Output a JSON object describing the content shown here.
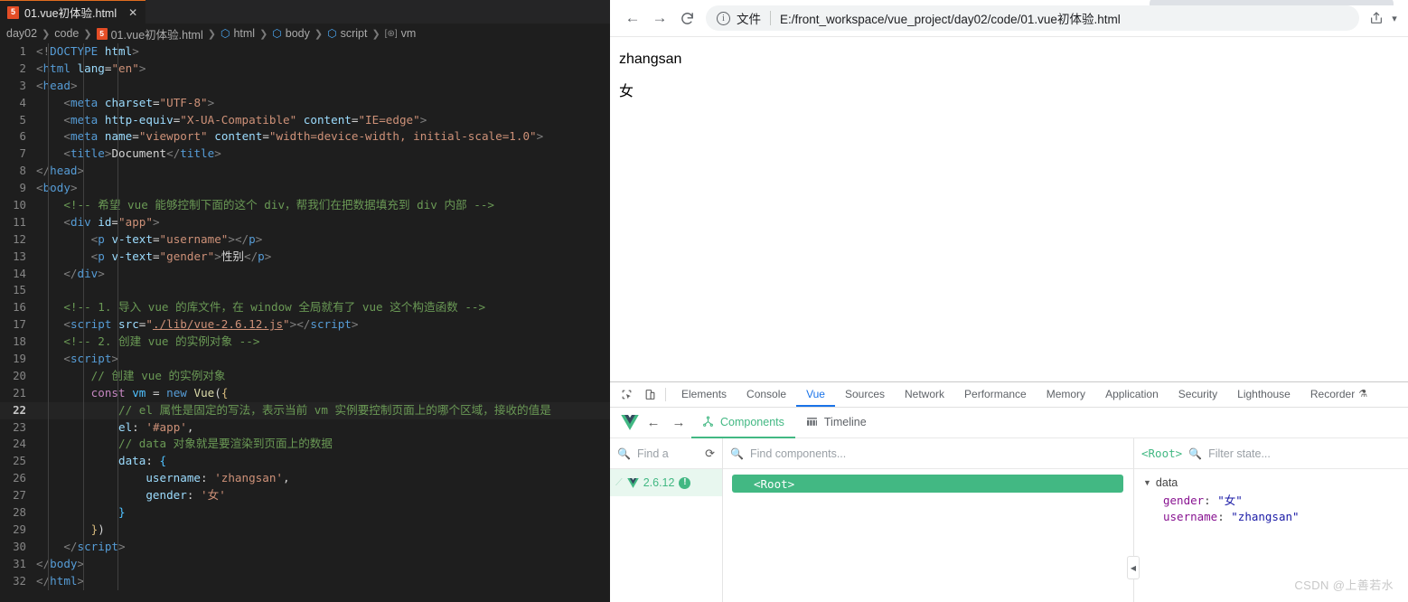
{
  "editor": {
    "tab": {
      "label": "01.vue初体验.html",
      "icon": "html5-icon",
      "close": "✕"
    },
    "breadcrumb": [
      "day02",
      "code",
      "01.vue初体验.html",
      "html",
      "body",
      "script",
      "vm"
    ],
    "lines": [
      {
        "n": 1,
        "html": "<span class='t-brk'>&lt;!</span><span class='t-tag'>DOCTYPE</span> <span class='t-attr'>html</span><span class='t-brk'>&gt;</span>"
      },
      {
        "n": 2,
        "html": "<span class='t-brk'>&lt;</span><span class='t-tag'>html</span> <span class='t-attr'>lang</span><span class='t-punc'>=</span><span class='t-str'>\"en\"</span><span class='t-brk'>&gt;</span>"
      },
      {
        "n": 3,
        "html": "<span class='t-brk'>&lt;</span><span class='t-tag'>head</span><span class='t-brk'>&gt;</span>"
      },
      {
        "n": 4,
        "html": "    <span class='t-brk'>&lt;</span><span class='t-tag'>meta</span> <span class='t-attr'>charset</span><span class='t-punc'>=</span><span class='t-str'>\"UTF-8\"</span><span class='t-brk'>&gt;</span>"
      },
      {
        "n": 5,
        "html": "    <span class='t-brk'>&lt;</span><span class='t-tag'>meta</span> <span class='t-attr'>http-equiv</span><span class='t-punc'>=</span><span class='t-str'>\"X-UA-Compatible\"</span> <span class='t-attr'>content</span><span class='t-punc'>=</span><span class='t-str'>\"IE=edge\"</span><span class='t-brk'>&gt;</span>"
      },
      {
        "n": 6,
        "html": "    <span class='t-brk'>&lt;</span><span class='t-tag'>meta</span> <span class='t-attr'>name</span><span class='t-punc'>=</span><span class='t-str'>\"viewport\"</span> <span class='t-attr'>content</span><span class='t-punc'>=</span><span class='t-str'>\"width=device-width, initial-scale=1.0\"</span><span class='t-brk'>&gt;</span>"
      },
      {
        "n": 7,
        "html": "    <span class='t-brk'>&lt;</span><span class='t-tag'>title</span><span class='t-brk'>&gt;</span><span class='t-txt'>Document</span><span class='t-brk'>&lt;/</span><span class='t-tag'>title</span><span class='t-brk'>&gt;</span>"
      },
      {
        "n": 8,
        "html": "<span class='t-brk'>&lt;/</span><span class='t-tag'>head</span><span class='t-brk'>&gt;</span>"
      },
      {
        "n": 9,
        "html": "<span class='t-brk'>&lt;</span><span class='t-tag'>body</span><span class='t-brk'>&gt;</span>"
      },
      {
        "n": 10,
        "html": "    <span class='t-cmt'>&lt;!-- 希望 vue 能够控制下面的这个 div，帮我们在把数据填充到 div 内部 --&gt;</span>"
      },
      {
        "n": 11,
        "html": "    <span class='t-brk'>&lt;</span><span class='t-tag'>div</span> <span class='t-attr'>id</span><span class='t-punc'>=</span><span class='t-str'>\"app\"</span><span class='t-brk'>&gt;</span>"
      },
      {
        "n": 12,
        "html": "        <span class='t-brk'>&lt;</span><span class='t-tag'>p</span> <span class='t-attr'>v-text</span><span class='t-punc'>=</span><span class='t-str'>\"username\"</span><span class='t-brk'>&gt;&lt;/</span><span class='t-tag'>p</span><span class='t-brk'>&gt;</span>"
      },
      {
        "n": 13,
        "html": "        <span class='t-brk'>&lt;</span><span class='t-tag'>p</span> <span class='t-attr'>v-text</span><span class='t-punc'>=</span><span class='t-str'>\"gender\"</span><span class='t-brk'>&gt;</span><span class='t-txt'>性别</span><span class='t-brk'>&lt;/</span><span class='t-tag'>p</span><span class='t-brk'>&gt;</span>"
      },
      {
        "n": 14,
        "html": "    <span class='t-brk'>&lt;/</span><span class='t-tag'>div</span><span class='t-brk'>&gt;</span>"
      },
      {
        "n": 15,
        "html": ""
      },
      {
        "n": 16,
        "html": "    <span class='t-cmt'>&lt;!-- 1. 导入 vue 的库文件，在 window 全局就有了 vue 这个构造函数 --&gt;</span>"
      },
      {
        "n": 17,
        "html": "    <span class='t-brk'>&lt;</span><span class='t-tag'>script</span> <span class='t-attr'>src</span><span class='t-punc'>=</span><span class='t-str'>\"</span><span class='t-link'>./lib/vue-2.6.12.js</span><span class='t-str'>\"</span><span class='t-brk'>&gt;&lt;/</span><span class='t-tag'>script</span><span class='t-brk'>&gt;</span>"
      },
      {
        "n": 18,
        "html": "    <span class='t-cmt'>&lt;!-- 2. 创建 vue 的实例对象 --&gt;</span>"
      },
      {
        "n": 19,
        "html": "    <span class='t-brk'>&lt;</span><span class='t-tag'>script</span><span class='t-brk'>&gt;</span>"
      },
      {
        "n": 20,
        "html": "        <span class='t-cmt'>// 创建 vue 的实例对象</span>"
      },
      {
        "n": 21,
        "html": "        <span class='t-kw2'>const</span> <span class='t-var'>vm</span> <span class='t-punc'>=</span> <span class='t-kw'>new</span> <span class='t-fn'>Vue</span><span class='t-punc'>(</span><span class='t-yellow'>{</span>"
      },
      {
        "n": 22,
        "html": "            <span class='t-cmt'>// el 属性是固定的写法，表示当前 vm 实例要控制页面上的哪个区域，接收的值是</span>",
        "current": true
      },
      {
        "n": 23,
        "html": "            <span class='t-prop'>el</span><span class='t-punc'>:</span> <span class='t-str'>'#app'</span><span class='t-punc'>,</span>"
      },
      {
        "n": 24,
        "html": "            <span class='t-cmt'>// data 对象就是要渲染到页面上的数据</span>"
      },
      {
        "n": 25,
        "html": "            <span class='t-prop'>data</span><span class='t-punc'>:</span> <span class='t-var'>{</span>"
      },
      {
        "n": 26,
        "html": "                <span class='t-prop'>username</span><span class='t-punc'>:</span> <span class='t-str'>'zhangsan'</span><span class='t-punc'>,</span>"
      },
      {
        "n": 27,
        "html": "                <span class='t-prop'>gender</span><span class='t-punc'>:</span> <span class='t-str'>'女'</span>"
      },
      {
        "n": 28,
        "html": "            <span class='t-var'>}</span>"
      },
      {
        "n": 29,
        "html": "        <span class='t-yellow'>}</span><span class='t-punc'>)</span>"
      },
      {
        "n": 30,
        "html": "    <span class='t-brk'>&lt;/</span><span class='t-tag'>script</span><span class='t-brk'>&gt;</span>"
      },
      {
        "n": 31,
        "html": "<span class='t-brk'>&lt;/</span><span class='t-tag'>body</span><span class='t-brk'>&gt;</span>"
      },
      {
        "n": 32,
        "html": "<span class='t-brk'>&lt;/</span><span class='t-tag'>html</span><span class='t-brk'>&gt;</span>"
      }
    ]
  },
  "browser": {
    "back_icon": "←",
    "forward_icon": "→",
    "reload_icon": "⟳",
    "info_icon": "i",
    "scheme_label": "文件",
    "url": "E:/front_workspace/vue_project/day02/code/01.vue初体验.html",
    "share_icon": "share-icon",
    "menu_icon": "▾",
    "page": {
      "username": "zhangsan",
      "gender": "女"
    }
  },
  "devtools": {
    "inspect_icon": "inspect-icon",
    "device_icon": "device-toolbar-icon",
    "tabs": [
      {
        "label": "Elements",
        "active": false
      },
      {
        "label": "Console",
        "active": false
      },
      {
        "label": "Vue",
        "active": true
      },
      {
        "label": "Sources",
        "active": false
      },
      {
        "label": "Network",
        "active": false
      },
      {
        "label": "Performance",
        "active": false
      },
      {
        "label": "Memory",
        "active": false
      },
      {
        "label": "Application",
        "active": false
      },
      {
        "label": "Security",
        "active": false
      },
      {
        "label": "Lighthouse",
        "active": false
      },
      {
        "label": "Recorder",
        "active": false,
        "beaker": "⚗"
      }
    ],
    "vue": {
      "logo": "vue-logo",
      "back_icon": "←",
      "forward_icon": "→",
      "subtabs": [
        {
          "label": "Components",
          "active": true,
          "icon": "components-icon"
        },
        {
          "label": "Timeline",
          "active": false,
          "icon": "timeline-icon"
        }
      ],
      "find_app_placeholder": "Find a",
      "refresh_icon": "⟳",
      "version": "2.6.12",
      "version_badge": "!",
      "find_components_placeholder": "Find components...",
      "component_root": "<Root>",
      "state_root": "<Root>",
      "filter_state_placeholder": "Filter state...",
      "state_group": "data",
      "state_rows": [
        {
          "key": "gender",
          "value": "\"女\""
        },
        {
          "key": "username",
          "value": "\"zhangsan\""
        }
      ],
      "collapse_icon": "◀"
    }
  },
  "watermark": "CSDN @上善若水"
}
